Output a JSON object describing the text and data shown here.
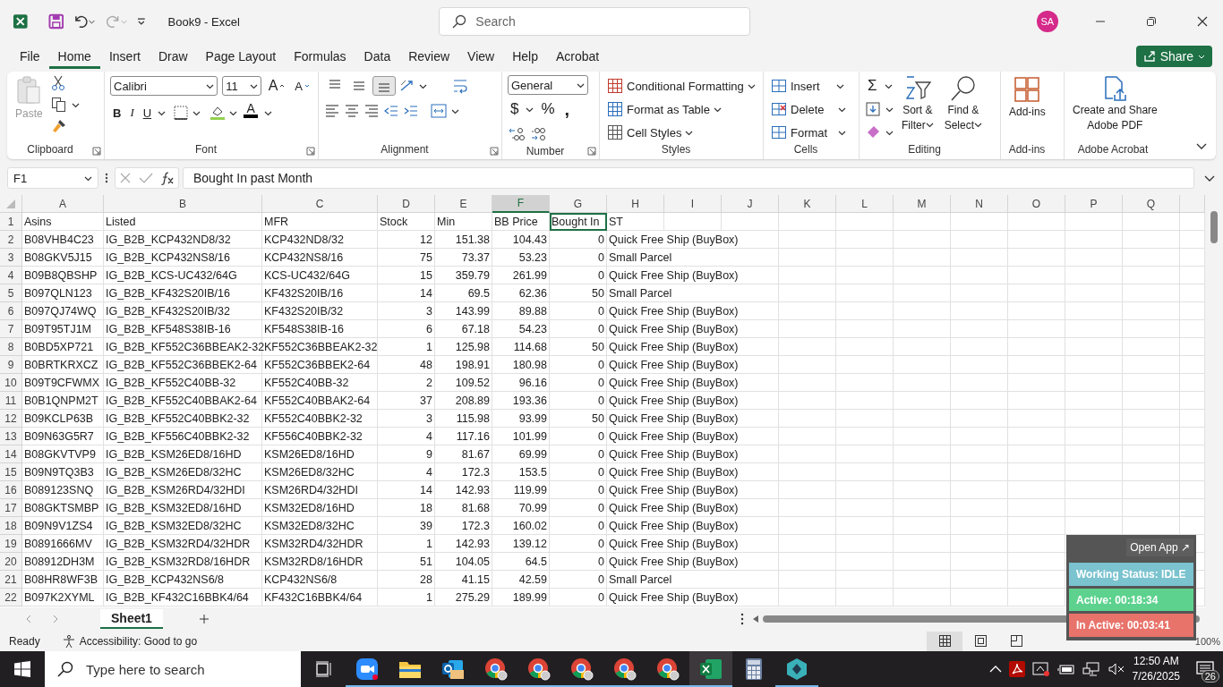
{
  "title_bar": {
    "title": "Book9  -  Excel",
    "search_placeholder": "Search",
    "avatar": "SA"
  },
  "menu_tabs": [
    {
      "label": "File",
      "selected": false
    },
    {
      "label": "Home",
      "selected": true
    },
    {
      "label": "Insert",
      "selected": false
    },
    {
      "label": "Draw",
      "selected": false
    },
    {
      "label": "Page Layout",
      "selected": false
    },
    {
      "label": "Formulas",
      "selected": false
    },
    {
      "label": "Data",
      "selected": false
    },
    {
      "label": "Review",
      "selected": false
    },
    {
      "label": "View",
      "selected": false
    },
    {
      "label": "Help",
      "selected": false
    },
    {
      "label": "Acrobat",
      "selected": false
    }
  ],
  "share": "Share",
  "ribbon": {
    "clipboard": {
      "paste": "Paste",
      "label": "Clipboard"
    },
    "font": {
      "name": "Calibri",
      "size": "11",
      "grow": "A",
      "shrink": "A",
      "styles": [
        "B",
        "I",
        "U"
      ],
      "color_letter": "A",
      "label": "Font"
    },
    "alignment": {
      "vertical": [
        {
          "kind": "top",
          "selected": false
        },
        {
          "kind": "middle",
          "selected": false
        },
        {
          "kind": "bottom",
          "selected": true
        }
      ],
      "label": "Alignment"
    },
    "number": {
      "format": "General",
      "currency": "$",
      "percent": "%",
      "comma": ",",
      "label": "Number"
    },
    "styles": {
      "items": [
        "Conditional Formatting",
        "Format as Table",
        "Cell Styles"
      ],
      "label": "Styles"
    },
    "cells": {
      "items": [
        "Insert",
        "Delete",
        "Format"
      ],
      "label": "Cells"
    },
    "editing": {
      "sigma": "Σ",
      "buttons": [
        [
          "Sort &",
          "Filter"
        ],
        [
          "Find &",
          "Select"
        ]
      ],
      "label": "Editing"
    },
    "addins": {
      "button": "Add-ins",
      "label": "Add-ins"
    },
    "adobe": {
      "lines": [
        "Create and Share",
        "Adobe PDF"
      ],
      "label": "Adobe Acrobat"
    }
  },
  "formula_bar": {
    "name_box": "F1",
    "formula": "Bought In past Month"
  },
  "columns": [
    {
      "label": "A",
      "selected": false
    },
    {
      "label": "B",
      "selected": false
    },
    {
      "label": "C",
      "selected": false
    },
    {
      "label": "D",
      "selected": false
    },
    {
      "label": "E",
      "selected": false
    },
    {
      "label": "F",
      "selected": true
    },
    {
      "label": "G",
      "selected": false
    },
    {
      "label": "H",
      "selected": false
    },
    {
      "label": "I",
      "selected": false
    },
    {
      "label": "J",
      "selected": false
    },
    {
      "label": "K",
      "selected": false
    },
    {
      "label": "L",
      "selected": false
    },
    {
      "label": "M",
      "selected": false
    },
    {
      "label": "N",
      "selected": false
    },
    {
      "label": "O",
      "selected": false
    },
    {
      "label": "P",
      "selected": false
    },
    {
      "label": "Q",
      "selected": false
    }
  ],
  "header_row": {
    "label": "1",
    "cells": [
      {
        "text": "Asins",
        "selected": false
      },
      {
        "text": "Listed",
        "selected": false
      },
      {
        "text": "MFR",
        "selected": false
      },
      {
        "text": "Stock",
        "selected": false
      },
      {
        "text": "Min",
        "selected": false
      },
      {
        "text": "BB Price",
        "selected": false
      },
      {
        "text": "Bought In",
        "selected": true
      },
      {
        "text": "ST",
        "selected": false
      }
    ]
  },
  "rows": [
    {
      "label": "2",
      "cells": [
        "B08VHB4C23",
        "IG_B2B_KCP432ND8/32",
        "KCP432ND8/32",
        "12",
        "151.38",
        "104.43",
        "0",
        "Quick Free Ship (BuyBox)"
      ]
    },
    {
      "label": "3",
      "cells": [
        "B08GKV5J15",
        "IG_B2B_KCP432NS8/16",
        "KCP432NS8/16",
        "75",
        "73.37",
        "53.23",
        "0",
        "Small Parcel"
      ]
    },
    {
      "label": "4",
      "cells": [
        "B09B8QBSHP",
        "IG_B2B_KCS-UC432/64G",
        "KCS-UC432/64G",
        "15",
        "359.79",
        "261.99",
        "0",
        "Quick Free Ship (BuyBox)"
      ]
    },
    {
      "label": "5",
      "cells": [
        "B097QLN123",
        "IG_B2B_KF432S20IB/16",
        "KF432S20IB/16",
        "14",
        "69.5",
        "62.36",
        "50",
        "Small Parcel"
      ]
    },
    {
      "label": "6",
      "cells": [
        "B097QJ74WQ",
        "IG_B2B_KF432S20IB/32",
        "KF432S20IB/32",
        "3",
        "143.99",
        "89.88",
        "0",
        "Quick Free Ship (BuyBox)"
      ]
    },
    {
      "label": "7",
      "cells": [
        "B09T95TJ1M",
        "IG_B2B_KF548S38IB-16",
        "KF548S38IB-16",
        "6",
        "67.18",
        "54.23",
        "0",
        "Quick Free Ship (BuyBox)"
      ]
    },
    {
      "label": "8",
      "cells": [
        "B0BD5XP721",
        "IG_B2B_KF552C36BBEAK2-32",
        "KF552C36BBEAK2-32",
        "1",
        "125.98",
        "114.68",
        "50",
        "Quick Free Ship (BuyBox)"
      ]
    },
    {
      "label": "9",
      "cells": [
        "B0BRTKRXCZ",
        "IG_B2B_KF552C36BBEK2-64",
        "KF552C36BBEK2-64",
        "48",
        "198.91",
        "180.98",
        "0",
        "Quick Free Ship (BuyBox)"
      ]
    },
    {
      "label": "10",
      "cells": [
        "B09T9CFWMX",
        "IG_B2B_KF552C40BB-32",
        "KF552C40BB-32",
        "2",
        "109.52",
        "96.16",
        "0",
        "Quick Free Ship (BuyBox)"
      ]
    },
    {
      "label": "11",
      "cells": [
        "B0B1QNPM2T",
        "IG_B2B_KF552C40BBAK2-64",
        "KF552C40BBAK2-64",
        "37",
        "208.89",
        "193.36",
        "0",
        "Quick Free Ship (BuyBox)"
      ]
    },
    {
      "label": "12",
      "cells": [
        "B09KCLP63B",
        "IG_B2B_KF552C40BBK2-32",
        "KF552C40BBK2-32",
        "3",
        "115.98",
        "93.99",
        "50",
        "Quick Free Ship (BuyBox)"
      ]
    },
    {
      "label": "13",
      "cells": [
        "B09N63G5R7",
        "IG_B2B_KF556C40BBK2-32",
        "KF556C40BBK2-32",
        "4",
        "117.16",
        "101.99",
        "0",
        "Quick Free Ship (BuyBox)"
      ]
    },
    {
      "label": "14",
      "cells": [
        "B08GKVTVP9",
        "IG_B2B_KSM26ED8/16HD",
        "KSM26ED8/16HD",
        "9",
        "81.67",
        "69.99",
        "0",
        "Quick Free Ship (BuyBox)"
      ]
    },
    {
      "label": "15",
      "cells": [
        "B09N9TQ3B3",
        "IG_B2B_KSM26ED8/32HC",
        "KSM26ED8/32HC",
        "4",
        "172.3",
        "153.5",
        "0",
        "Quick Free Ship (BuyBox)"
      ]
    },
    {
      "label": "16",
      "cells": [
        "B089123SNQ",
        "IG_B2B_KSM26RD4/32HDI",
        "KSM26RD4/32HDI",
        "14",
        "142.93",
        "119.99",
        "0",
        "Quick Free Ship (BuyBox)"
      ]
    },
    {
      "label": "17",
      "cells": [
        "B08GKTSMBP",
        "IG_B2B_KSM32ED8/16HD",
        "KSM32ED8/16HD",
        "18",
        "81.68",
        "70.99",
        "0",
        "Quick Free Ship (BuyBox)"
      ]
    },
    {
      "label": "18",
      "cells": [
        "B09N9V1ZS4",
        "IG_B2B_KSM32ED8/32HC",
        "KSM32ED8/32HC",
        "39",
        "172.3",
        "160.02",
        "0",
        "Quick Free Ship (BuyBox)"
      ]
    },
    {
      "label": "19",
      "cells": [
        "B0891666MV",
        "IG_B2B_KSM32RD4/32HDR",
        "KSM32RD4/32HDR",
        "1",
        "142.93",
        "139.12",
        "0",
        "Quick Free Ship (BuyBox)"
      ]
    },
    {
      "label": "20",
      "cells": [
        "B08912DH3M",
        "IG_B2B_KSM32RD8/16HDR",
        "KSM32RD8/16HDR",
        "51",
        "104.05",
        "64.5",
        "0",
        "Quick Free Ship (BuyBox)"
      ]
    },
    {
      "label": "21",
      "cells": [
        "B08HR8WF3B",
        "IG_B2B_KCP432NS6/8",
        "KCP432NS6/8",
        "28",
        "41.15",
        "42.59",
        "0",
        "Small Parcel"
      ]
    },
    {
      "label": "22",
      "cells": [
        "B097K2XYML",
        "IG_B2B_KF432C16BBK4/64",
        "KF432C16BBK4/64",
        "1",
        "275.29",
        "189.99",
        "0",
        "Quick Free Ship (BuyBox)"
      ]
    }
  ],
  "sheet_tabs": [
    {
      "label": "Sheet1",
      "selected": true
    }
  ],
  "status_bar": {
    "ready": "Ready",
    "accessibility": "Accessibility: Good to go",
    "views": [
      {
        "kind": "normal",
        "selected": true
      },
      {
        "kind": "page_layout",
        "selected": false
      },
      {
        "kind": "page_break",
        "selected": false
      }
    ],
    "zoom": "100%"
  },
  "status_widget": {
    "open_app": "Open App ↗",
    "items": [
      {
        "text": "Working Status: IDLE",
        "color": "#7ac3cf"
      },
      {
        "text": "Active: 00:18:34",
        "color": "#5dd28e"
      },
      {
        "text": "In Active: 00:03:41",
        "color": "#e8736b"
      }
    ]
  },
  "taskbar": {
    "search_placeholder": "Type here to search",
    "apps": [
      {
        "kind": "zoom",
        "running": true,
        "active": false
      },
      {
        "kind": "folder",
        "running": true,
        "active": false
      },
      {
        "kind": "outlook",
        "running": true,
        "active": false
      },
      {
        "kind": "chrome",
        "running": true,
        "active": false
      },
      {
        "kind": "chrome",
        "running": true,
        "active": false
      },
      {
        "kind": "chrome",
        "running": true,
        "active": false
      },
      {
        "kind": "chrome",
        "running": true,
        "active": false
      },
      {
        "kind": "chrome",
        "running": true,
        "active": false
      },
      {
        "kind": "excel",
        "running": true,
        "active": true
      },
      {
        "kind": "calculator",
        "running": false,
        "active": false
      },
      {
        "kind": "hexagon",
        "running": true,
        "active": false
      }
    ],
    "time": "12:50 AM",
    "date": "7/26/2025",
    "notifications": "26"
  }
}
